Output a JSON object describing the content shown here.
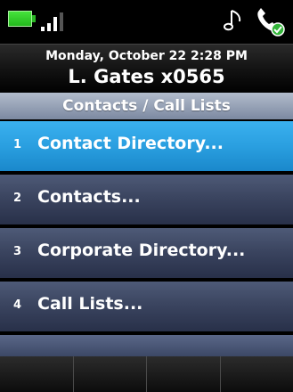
{
  "status": {
    "battery_icon": "battery-icon",
    "signal_icon": "signal-strength-icon",
    "ringtone_icon": "music-note-icon",
    "handset_icon": "handset-icon"
  },
  "header": {
    "datetime": "Monday, October 22 2:28 PM",
    "user_line": "L. Gates x0565"
  },
  "title": "Contacts / Call Lists",
  "menu": {
    "items": [
      {
        "number": "1",
        "label": "Contact Directory...",
        "selected": true
      },
      {
        "number": "2",
        "label": "Contacts..."
      },
      {
        "number": "3",
        "label": "Corporate Directory..."
      },
      {
        "number": "4",
        "label": "Call Lists..."
      }
    ]
  },
  "colors": {
    "selected_item": "#2a9fe0",
    "menu_item": "#3b4560",
    "title_bar": "#9aa6bb",
    "battery": "#2fd42a"
  }
}
